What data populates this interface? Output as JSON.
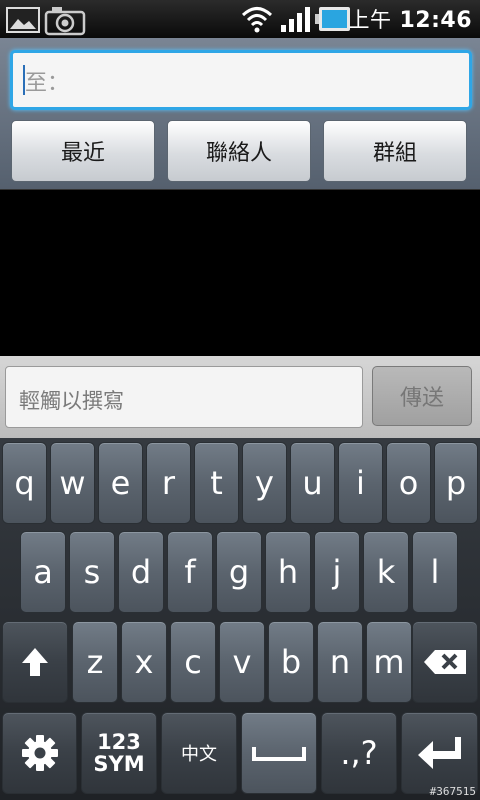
{
  "status_bar": {
    "ampm": "上午",
    "time": "12:46",
    "icons": [
      "image-notification-icon",
      "camera-notification-icon",
      "wifi-icon",
      "signal-icon",
      "battery-icon"
    ]
  },
  "recipient": {
    "to_label": "至："
  },
  "tabs": [
    {
      "label": "最近"
    },
    {
      "label": "聯絡人"
    },
    {
      "label": "群組"
    }
  ],
  "compose": {
    "placeholder": "輕觸以撰寫",
    "send_label": "傳送"
  },
  "keyboard": {
    "row1": [
      "q",
      "w",
      "e",
      "r",
      "t",
      "y",
      "u",
      "i",
      "o",
      "p"
    ],
    "row2": [
      "a",
      "s",
      "d",
      "f",
      "g",
      "h",
      "j",
      "k",
      "l"
    ],
    "row3": [
      "z",
      "x",
      "c",
      "v",
      "b",
      "n",
      "m"
    ],
    "sym_top": "123",
    "sym_bottom": "SYM",
    "lang": "中文",
    "punct": ".,?"
  },
  "watermark": "#367515",
  "colors": {
    "focus_border": "#2fa6e6",
    "panel": "#6a7583",
    "key": "#5b646e"
  }
}
